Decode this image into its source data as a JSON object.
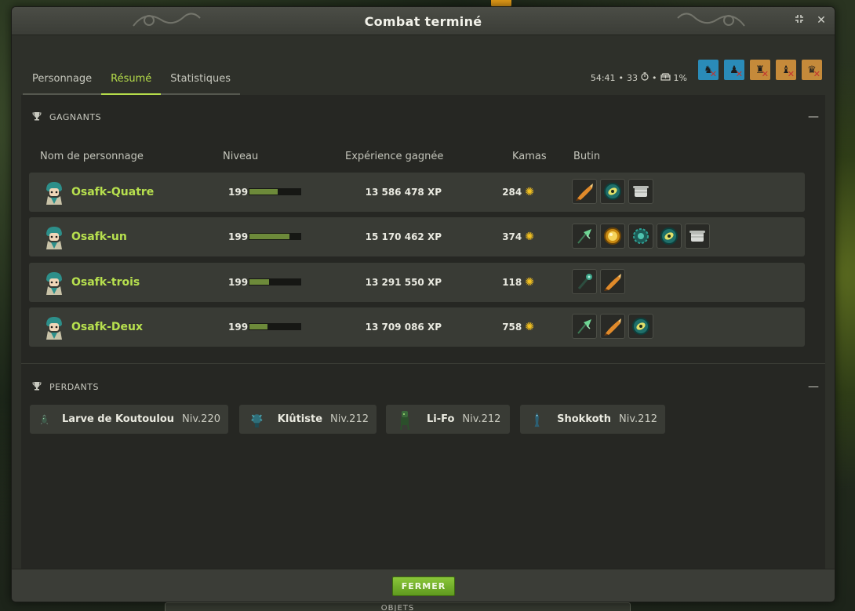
{
  "window": {
    "title": "Combat terminé",
    "minimize_icon": "collapse-arrows-icon",
    "close_icon": "close-icon"
  },
  "tabs": [
    {
      "label": "Personnage",
      "active": false
    },
    {
      "label": "Résumé",
      "active": true
    },
    {
      "label": "Statistiques",
      "active": false
    }
  ],
  "fight_info": {
    "duration": "54:41",
    "turns": "33",
    "bonus": "1%"
  },
  "challenges": [
    {
      "icon": "challenge-icon-1",
      "color": "#2a8bb8",
      "failed": true
    },
    {
      "icon": "challenge-icon-2",
      "color": "#2a8bb8",
      "failed": true
    },
    {
      "icon": "challenge-icon-3",
      "color": "#c58a3a",
      "failed": true
    },
    {
      "icon": "challenge-icon-4",
      "color": "#c58a3a",
      "failed": true
    },
    {
      "icon": "challenge-icon-5",
      "color": "#c58a3a",
      "failed": true
    }
  ],
  "winners": {
    "title": "GAGNANTS",
    "columns": {
      "name": "Nom de personnage",
      "level": "Niveau",
      "xp": "Expérience gagnée",
      "kamas": "Kamas",
      "loot": "Butin"
    },
    "rows": [
      {
        "name": "Osafk-Quatre",
        "level": "199",
        "level_progress": 0.55,
        "xp": "13 586 478 XP",
        "kamas": "284",
        "loot": [
          "horn-item-icon",
          "dofus-eye-item-icon",
          "scroll-item-icon"
        ]
      },
      {
        "name": "Osafk-un",
        "level": "199",
        "level_progress": 0.78,
        "xp": "15 170 462 XP",
        "kamas": "374",
        "loot": [
          "feather-item-icon",
          "gold-orb-item-icon",
          "green-gear-item-icon",
          "dofus-eye-item-icon",
          "scroll-item-icon"
        ]
      },
      {
        "name": "Osafk-trois",
        "level": "199",
        "level_progress": 0.38,
        "xp": "13 291 550 XP",
        "kamas": "118",
        "loot": [
          "staff-item-icon",
          "horn-item-icon"
        ]
      },
      {
        "name": "Osafk-Deux",
        "level": "199",
        "level_progress": 0.35,
        "xp": "13 709 086 XP",
        "kamas": "758",
        "loot": [
          "feather-item-icon",
          "horn-item-icon",
          "dofus-eye-item-icon"
        ]
      }
    ]
  },
  "losers": {
    "title": "PERDANTS",
    "items": [
      {
        "name": "Larve de Koutoulou",
        "level": "Niv.220"
      },
      {
        "name": "Klûtiste",
        "level": "Niv.212"
      },
      {
        "name": "Li-Fo",
        "level": "Niv.212"
      },
      {
        "name": "Shokkoth",
        "level": "Niv.212"
      }
    ]
  },
  "footer": {
    "close_label": "FERMER"
  },
  "background": {
    "bottom_bar_label": "OBJETS"
  }
}
